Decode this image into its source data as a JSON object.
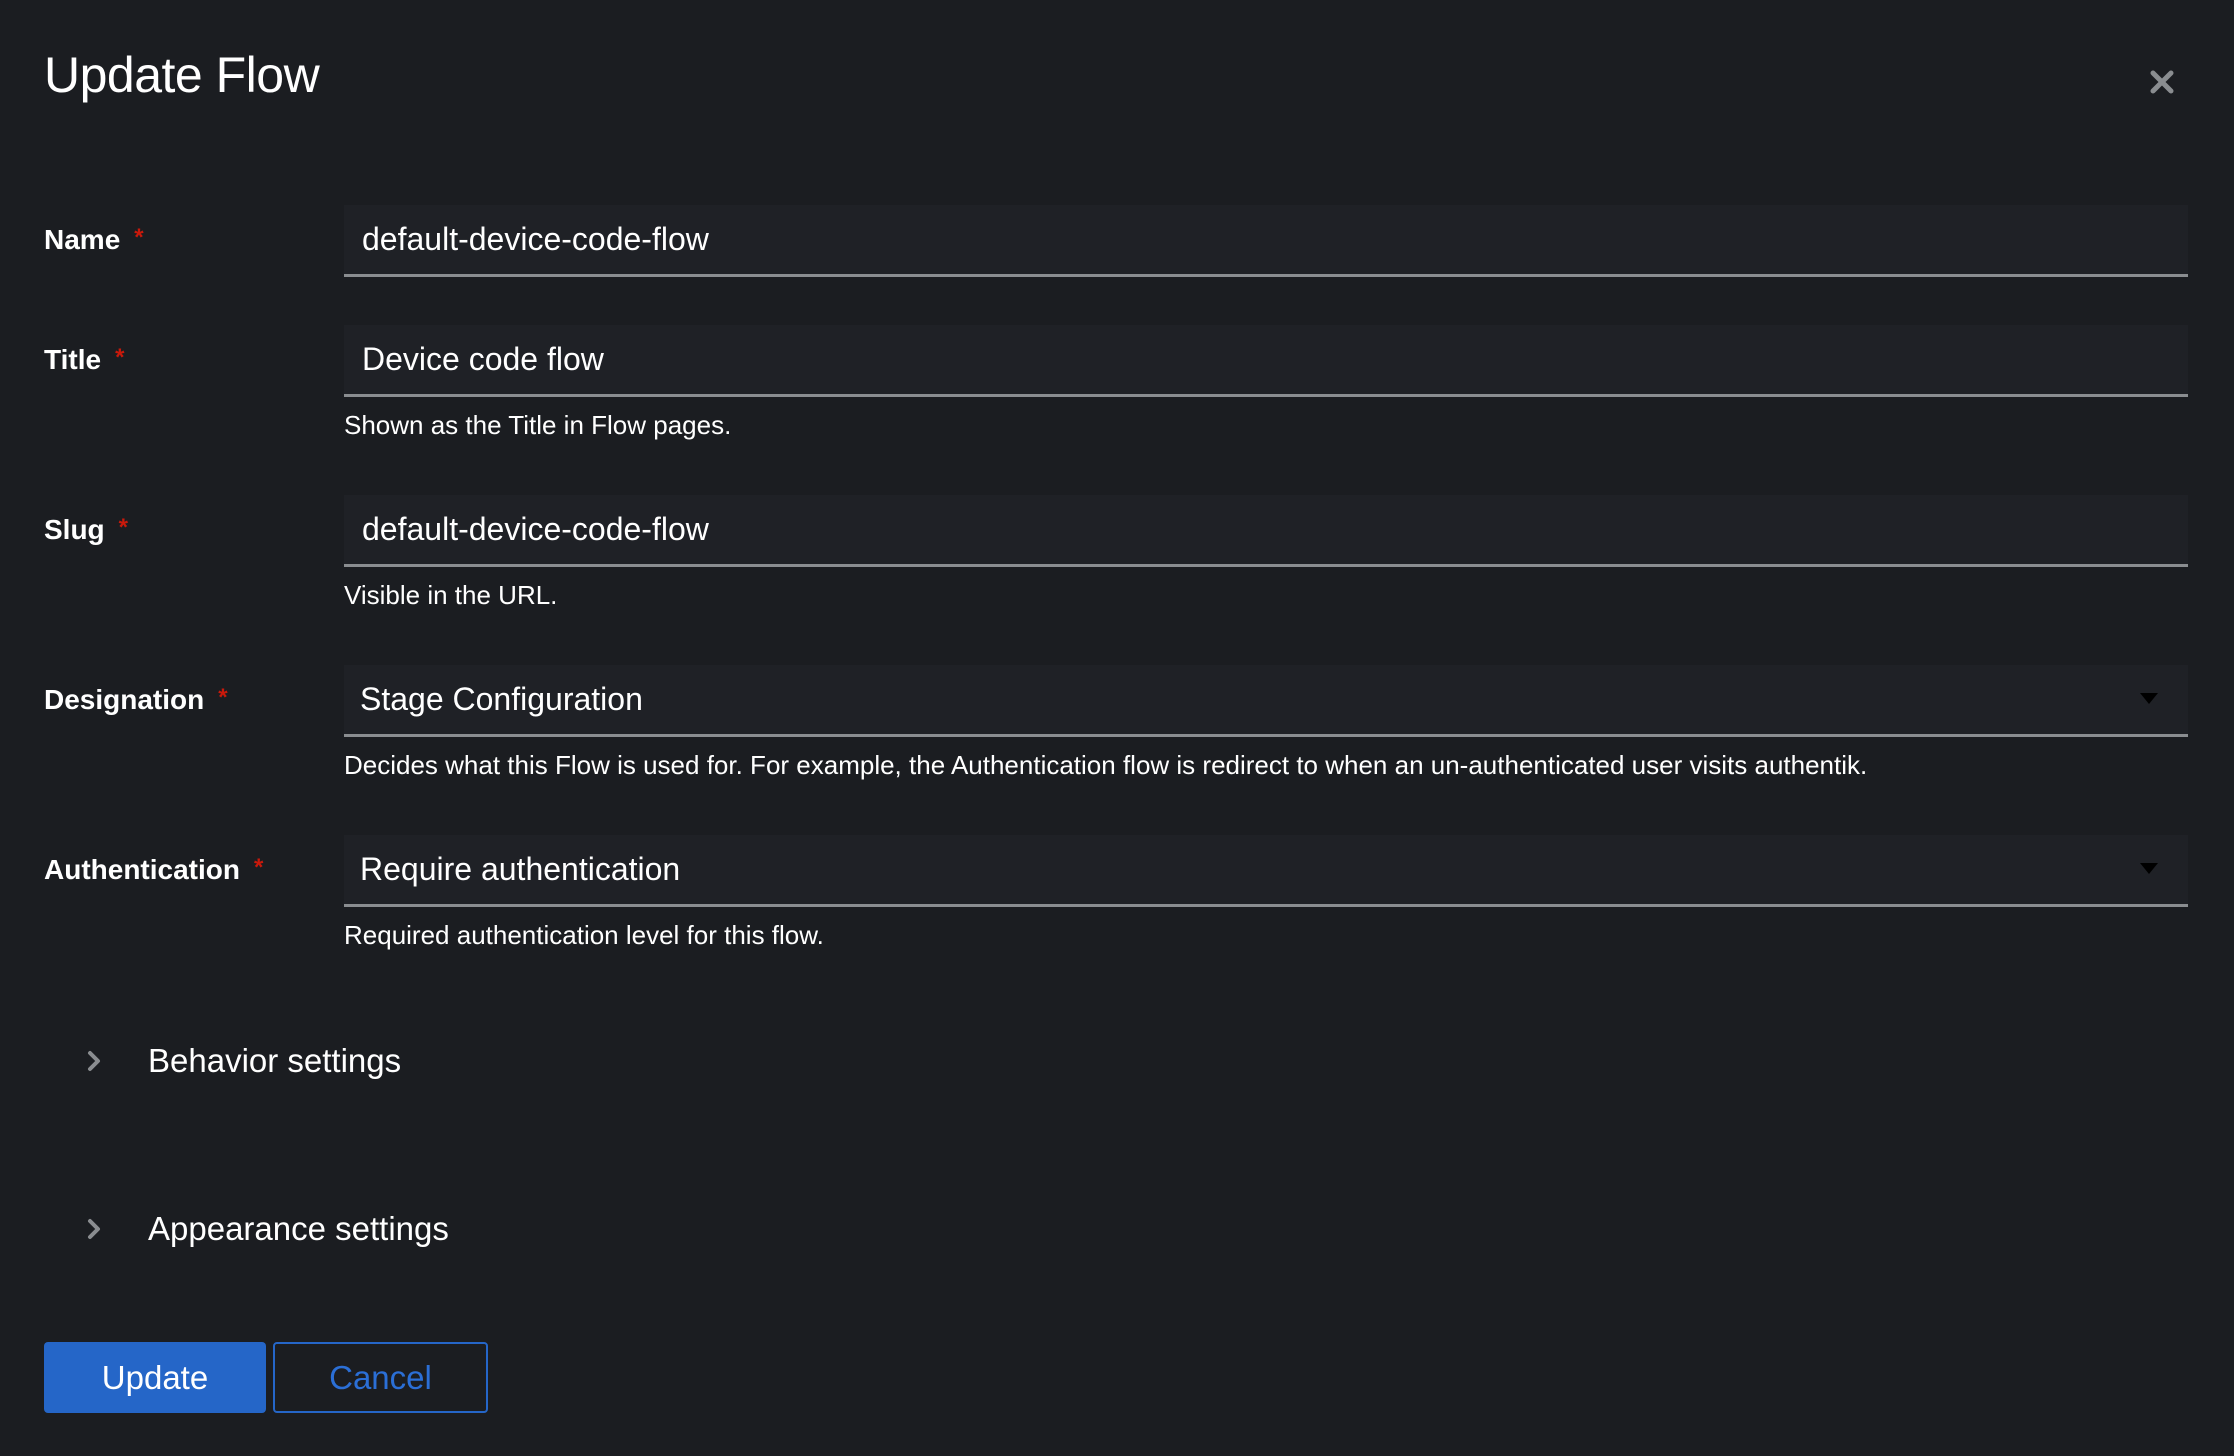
{
  "modal": {
    "title": "Update Flow",
    "close_icon": "close-icon"
  },
  "form": {
    "required_marker": "*",
    "fields": {
      "name": {
        "label": "Name",
        "value": "default-device-code-flow",
        "required": true
      },
      "title": {
        "label": "Title",
        "value": "Device code flow",
        "required": true,
        "helper": "Shown as the Title in Flow pages."
      },
      "slug": {
        "label": "Slug",
        "value": "default-device-code-flow",
        "required": true,
        "helper": "Visible in the URL."
      },
      "designation": {
        "label": "Designation",
        "selected": "Stage Configuration",
        "required": true,
        "helper": "Decides what this Flow is used for. For example, the Authentication flow is redirect to when an un-authenticated user visits authentik."
      },
      "authentication": {
        "label": "Authentication",
        "selected": "Require authentication",
        "required": true,
        "helper": "Required authentication level for this flow."
      }
    },
    "sections": [
      {
        "label": "Behavior settings",
        "expanded": false,
        "icon": "chevron-right-icon"
      },
      {
        "label": "Appearance settings",
        "expanded": false,
        "icon": "chevron-right-icon"
      }
    ]
  },
  "actions": {
    "update_label": "Update",
    "cancel_label": "Cancel"
  },
  "colors": {
    "background": "#1b1d21",
    "input_background": "#1f2126",
    "required": "#c9190b",
    "primary": "#2566c8"
  }
}
